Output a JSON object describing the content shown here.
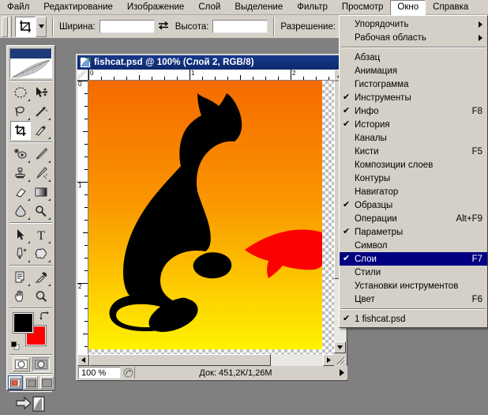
{
  "menubar": {
    "items": [
      {
        "label": "Файл",
        "active": false
      },
      {
        "label": "Редактирование",
        "active": false
      },
      {
        "label": "Изображение",
        "active": false
      },
      {
        "label": "Слой",
        "active": false
      },
      {
        "label": "Выделение",
        "active": false
      },
      {
        "label": "Фильтр",
        "active": false
      },
      {
        "label": "Просмотр",
        "active": false
      },
      {
        "label": "Окно",
        "active": true
      },
      {
        "label": "Справка",
        "active": false
      }
    ]
  },
  "options_bar": {
    "tool_icon": "crop-tool-icon",
    "dropdown_icon": "chevron-down-icon",
    "width_label": "Ширина:",
    "width_value": "",
    "swap_icon": "swap-arrows-icon",
    "height_label": "Высота:",
    "height_value": "",
    "resolution_label": "Разрешение:",
    "resolution_value": ""
  },
  "toolbox": {
    "logo": "photoshop-feather-logo",
    "groups": [
      {
        "rows": [
          {
            "left": {
              "icon": "elliptical-marquee-icon",
              "selected": false,
              "has_more": true
            },
            "right": {
              "icon": "move-tool-icon",
              "selected": false,
              "has_more": false
            }
          },
          {
            "left": {
              "icon": "lasso-tool-icon",
              "selected": false,
              "has_more": true
            },
            "right": {
              "icon": "magic-wand-icon",
              "selected": false,
              "has_more": false
            }
          },
          {
            "left": {
              "icon": "crop-tool-icon",
              "selected": true,
              "has_more": false
            },
            "right": {
              "icon": "slice-tool-icon",
              "selected": false,
              "has_more": true
            }
          }
        ]
      },
      {
        "rows": [
          {
            "left": {
              "icon": "healing-brush-icon",
              "selected": false,
              "has_more": true
            },
            "right": {
              "icon": "paint-brush-icon",
              "selected": false,
              "has_more": true
            }
          },
          {
            "left": {
              "icon": "clone-stamp-icon",
              "selected": false,
              "has_more": true
            },
            "right": {
              "icon": "history-brush-icon",
              "selected": false,
              "has_more": true
            }
          },
          {
            "left": {
              "icon": "eraser-tool-icon",
              "selected": false,
              "has_more": true
            },
            "right": {
              "icon": "gradient-tool-icon",
              "selected": false,
              "has_more": true
            }
          },
          {
            "left": {
              "icon": "blur-tool-icon",
              "selected": false,
              "has_more": true
            },
            "right": {
              "icon": "dodge-tool-icon",
              "selected": false,
              "has_more": true
            }
          }
        ]
      },
      {
        "rows": [
          {
            "left": {
              "icon": "path-selection-icon",
              "selected": false,
              "has_more": true
            },
            "right": {
              "icon": "type-tool-icon",
              "selected": false,
              "has_more": true
            }
          },
          {
            "left": {
              "icon": "pen-tool-icon",
              "selected": false,
              "has_more": true
            },
            "right": {
              "icon": "custom-shape-icon",
              "selected": false,
              "has_more": true
            }
          }
        ]
      },
      {
        "rows": [
          {
            "left": {
              "icon": "notes-tool-icon",
              "selected": false,
              "has_more": true
            },
            "right": {
              "icon": "eyedropper-icon",
              "selected": false,
              "has_more": true
            }
          },
          {
            "left": {
              "icon": "hand-tool-icon",
              "selected": false,
              "has_more": false
            },
            "right": {
              "icon": "zoom-tool-icon",
              "selected": false,
              "has_more": false
            }
          }
        ]
      }
    ],
    "colors": {
      "foreground": "#000000",
      "background": "#ff0000",
      "swap_icon": "swap-colors-icon",
      "default_icon": "default-colors-icon"
    },
    "quickmask": [
      {
        "icon": "standard-mode-icon",
        "selected": true
      },
      {
        "icon": "quick-mask-mode-icon",
        "selected": false
      }
    ],
    "screenmodes": [
      {
        "icon": "standard-screen-icon",
        "selected": true
      },
      {
        "icon": "full-screen-menubar-icon",
        "selected": false
      },
      {
        "icon": "full-screen-icon",
        "selected": false
      }
    ],
    "jump_to": {
      "icon": "jump-to-imageready-icon"
    }
  },
  "document_window": {
    "icon": "psd-document-icon",
    "title": "fishcat.psd @ 100% (Слой 2, RGB/8)",
    "rulers": {
      "unit_marks_h": [
        "0",
        "1",
        "2"
      ],
      "unit_marks_v": [
        "0",
        "1",
        "2"
      ]
    },
    "canvas": {
      "gradient_top": "#f57300",
      "gradient_bottom": "#fff000",
      "cat_color": "#000000",
      "fish_color": "#ff0000"
    },
    "status": {
      "zoom": "100 %",
      "grip_icon": "size-grip-icon",
      "doc_info": "Док: 451,2К/1,26М",
      "arrow_icon": "status-arrow-icon"
    },
    "scroll": {
      "up_icon": "scroll-up-icon",
      "down_icon": "scroll-down-icon",
      "left_icon": "scroll-left-icon",
      "right_icon": "scroll-right-icon",
      "resize_icon": "resize-grip-icon"
    }
  },
  "window_menu": {
    "items": [
      {
        "label": "Упорядочить",
        "checked": false,
        "accel": "",
        "submenu": true
      },
      {
        "label": "Рабочая область",
        "checked": false,
        "accel": "",
        "submenu": true
      },
      {
        "separator": true
      },
      {
        "label": "Абзац",
        "checked": false,
        "accel": "",
        "submenu": false
      },
      {
        "label": "Анимация",
        "checked": false,
        "accel": "",
        "submenu": false
      },
      {
        "label": "Гистограмма",
        "checked": false,
        "accel": "",
        "submenu": false
      },
      {
        "label": "Инструменты",
        "checked": true,
        "accel": "",
        "submenu": false
      },
      {
        "label": "Инфо",
        "checked": true,
        "accel": "F8",
        "submenu": false
      },
      {
        "label": "История",
        "checked": true,
        "accel": "",
        "submenu": false
      },
      {
        "label": "Каналы",
        "checked": false,
        "accel": "",
        "submenu": false
      },
      {
        "label": "Кисти",
        "checked": false,
        "accel": "F5",
        "submenu": false
      },
      {
        "label": "Композиции слоев",
        "checked": false,
        "accel": "",
        "submenu": false
      },
      {
        "label": "Контуры",
        "checked": false,
        "accel": "",
        "submenu": false
      },
      {
        "label": "Навигатор",
        "checked": false,
        "accel": "",
        "submenu": false
      },
      {
        "label": "Образцы",
        "checked": true,
        "accel": "",
        "submenu": false
      },
      {
        "label": "Операции",
        "checked": false,
        "accel": "Alt+F9",
        "submenu": false
      },
      {
        "label": "Параметры",
        "checked": true,
        "accel": "",
        "submenu": false
      },
      {
        "label": "Символ",
        "checked": false,
        "accel": "",
        "submenu": false
      },
      {
        "label": "Слои",
        "checked": true,
        "accel": "F7",
        "submenu": false,
        "highlighted": true
      },
      {
        "label": "Стили",
        "checked": false,
        "accel": "",
        "submenu": false
      },
      {
        "label": "Установки инструментов",
        "checked": false,
        "accel": "",
        "submenu": false
      },
      {
        "label": "Цвет",
        "checked": false,
        "accel": "F6",
        "submenu": false
      },
      {
        "separator": true
      },
      {
        "label": "1 fishcat.psd",
        "checked": true,
        "accel": "",
        "submenu": false
      }
    ],
    "check_glyph": "✔",
    "highlight_color": "#000080"
  }
}
